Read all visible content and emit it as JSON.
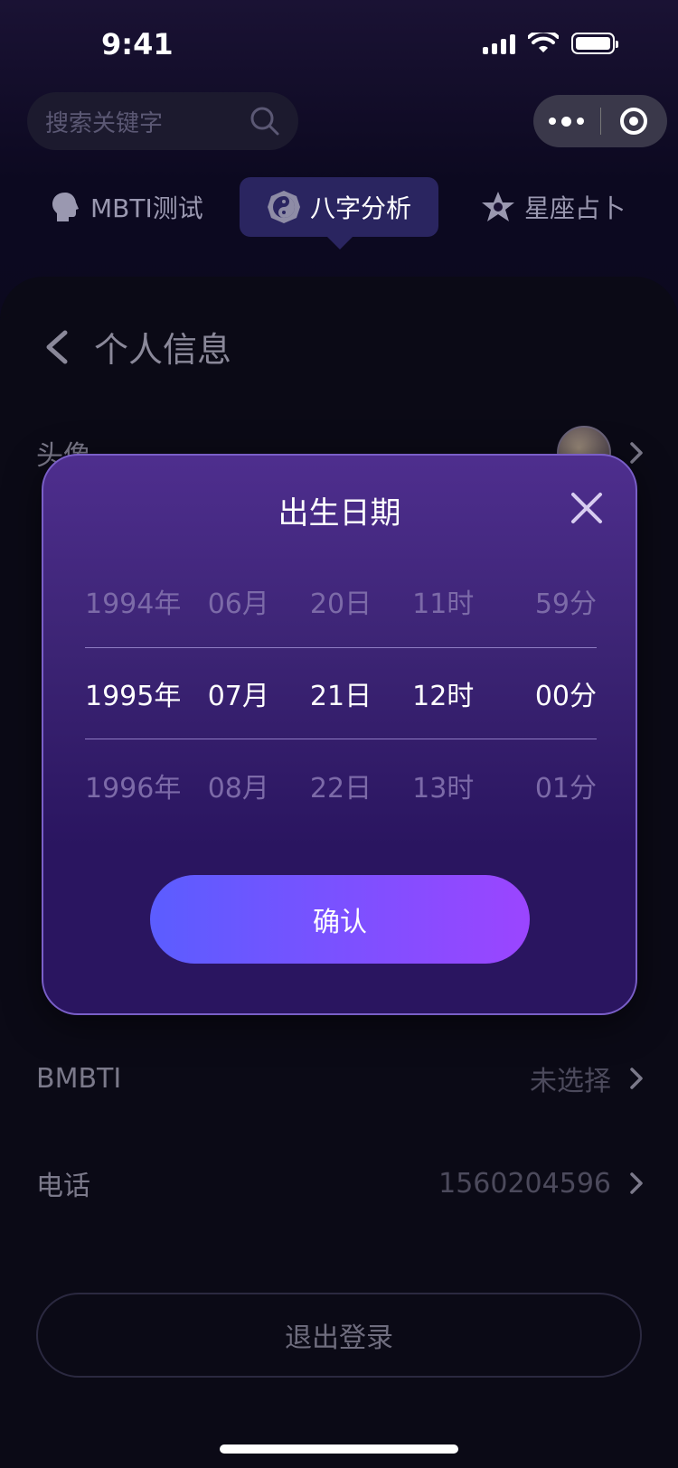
{
  "status_bar": {
    "time": "9:41"
  },
  "search": {
    "placeholder": "搜索关键字"
  },
  "tabs": [
    {
      "label": "MBTI测试",
      "icon": "head-icon"
    },
    {
      "label": "八字分析",
      "icon": "yin-yang-icon",
      "active": true
    },
    {
      "label": "星座占卜",
      "icon": "star-icon"
    }
  ],
  "page": {
    "title": "个人信息"
  },
  "rows": [
    {
      "label": "头像"
    },
    {
      "label": "BMBTI",
      "value": "未选择"
    },
    {
      "label": "电话",
      "value": "1560204596"
    }
  ],
  "logout_label": "退出登录",
  "modal": {
    "title": "出生日期",
    "picker": {
      "prev": [
        "1994年",
        "06月",
        "20日",
        "11时",
        "59分"
      ],
      "selected": [
        "1995年",
        "07月",
        "21日",
        "12时",
        "00分"
      ],
      "next": [
        "1996年",
        "08月",
        "22日",
        "13时",
        "01分"
      ]
    },
    "confirm_label": "确认"
  },
  "colors": {
    "accent_start": "#5b5dff",
    "accent_end": "#9b45ff",
    "tab_active_bg": "#2a2560"
  }
}
